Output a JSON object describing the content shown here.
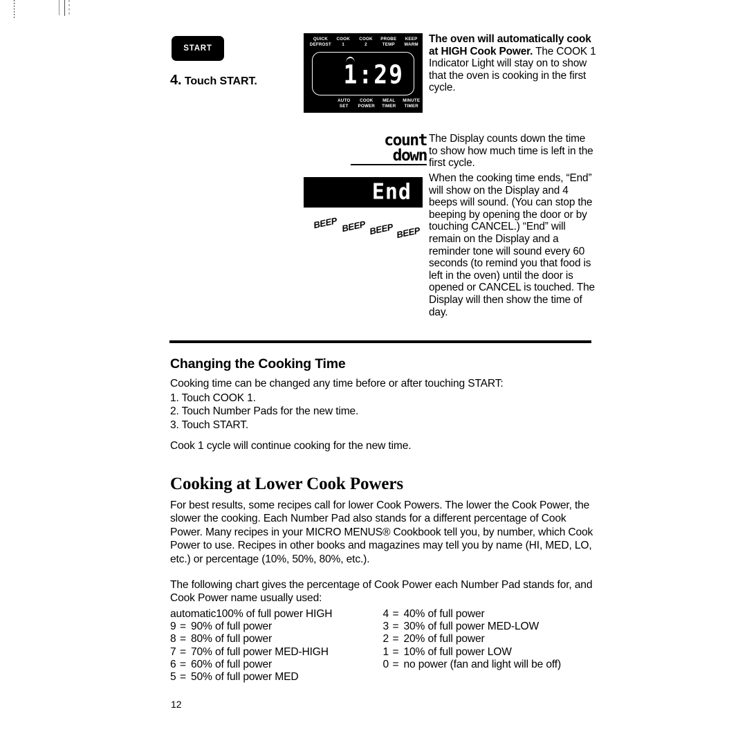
{
  "artifacts": {
    "present": true
  },
  "step": {
    "button_label": "START",
    "number": "4.",
    "text": "Touch START."
  },
  "oven_panel": {
    "top_labels": [
      "QUICK\nDEFROST",
      "COOK\n1",
      "COOK\n2",
      "PROBE\nTEMP",
      "KEEP\nWARM"
    ],
    "bottom_labels": [
      "AUTO\nSET",
      "COOK\nPOWER",
      "MEAL\nTIMER",
      "MINUTE\nTIMER"
    ],
    "display_value": "1:29"
  },
  "countdown_graphic": {
    "line1": "count",
    "line2": "down"
  },
  "end_display": {
    "text": "End"
  },
  "beeps": [
    "BEEP",
    "BEEP",
    "BEEP",
    "BEEP"
  ],
  "right_column": {
    "para1_bold": "The oven will automatically cook at HIGH Cook Power.",
    "para1_rest": "The COOK 1 Indicator Light will stay on to show that the oven is cooking in the first cycle.",
    "para2": "The Display counts down the time to show how much time is left in the first cycle.",
    "para3": "When the cooking time ends, “End” will show on the Display and 4 beeps will sound. (You can stop the beeping by opening the door or by touching CANCEL.) “End” will remain on the Display and a reminder tone will sound every 60 seconds (to remind you that food is left in the oven) until the door is opened or CANCEL is touched. The Display will then show the time of day."
  },
  "section1": {
    "title": "Changing the Cooking Time",
    "intro": "Cooking time can be changed any time before or after touching START:",
    "steps": [
      "1. Touch COOK 1.",
      "2. Touch Number Pads for the new time.",
      "3. Touch START."
    ],
    "outro": "Cook 1 cycle will continue cooking for the new time."
  },
  "section2": {
    "title": "Cooking at Lower Cook Powers",
    "para1": "For best results, some recipes call for lower Cook Powers. The lower the Cook Power, the slower the cooking. Each Number Pad also stands for a different percentage of Cook Power. Many recipes in your MICRO MENUS® Cookbook tell you, by number, which Cook Power to use. Recipes in other books and magazines may tell you by name (HI, MED, LO, etc.) or percentage (10%, 50%, 80%, etc.).",
    "para2": "The following chart gives the percentage of Cook Power each Number Pad stands for, and Cook Power name usually used:"
  },
  "power_chart": {
    "left": [
      {
        "key": "automatic",
        "eq": "",
        "value": "100% of full power HIGH",
        "auto": true
      },
      {
        "key": "9",
        "eq": "=",
        "value": "90% of full power"
      },
      {
        "key": "8",
        "eq": "=",
        "value": "80% of full power"
      },
      {
        "key": "7",
        "eq": "=",
        "value": "70% of full power MED-HIGH"
      },
      {
        "key": "6",
        "eq": "=",
        "value": "60% of full power"
      },
      {
        "key": "5",
        "eq": "=",
        "value": "50% of full power MED"
      }
    ],
    "right": [
      {
        "key": "4",
        "eq": "=",
        "value": "40% of full power"
      },
      {
        "key": "3",
        "eq": "=",
        "value": "30% of full power MED-LOW"
      },
      {
        "key": "2",
        "eq": "=",
        "value": "20% of full power"
      },
      {
        "key": "1",
        "eq": "=",
        "value": "10% of full power LOW"
      },
      {
        "key": "0",
        "eq": "=",
        "value": "no power (fan and light will be off)"
      }
    ]
  },
  "page_number": "12"
}
